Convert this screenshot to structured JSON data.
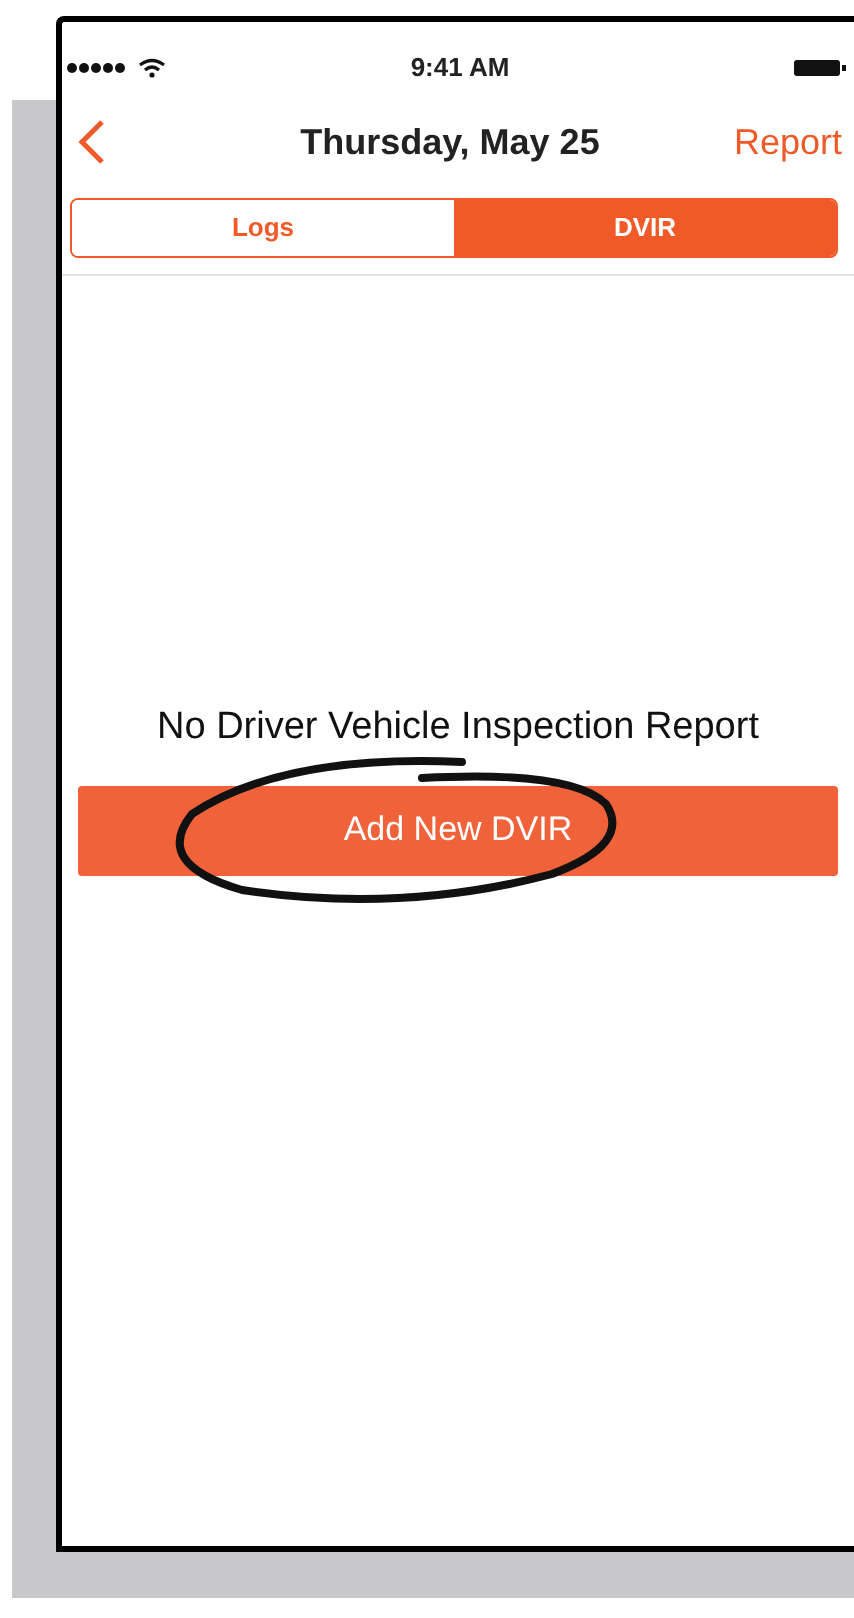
{
  "status_bar": {
    "time": "9:41 AM"
  },
  "nav": {
    "title": "Thursday, May 25",
    "action": "Report"
  },
  "tabs": [
    {
      "label": "Logs",
      "selected": false
    },
    {
      "label": "DVIR",
      "selected": true
    }
  ],
  "empty_state": {
    "message": "No Driver Vehicle Inspection Report",
    "button": "Add New DVIR",
    "circled": true
  }
}
